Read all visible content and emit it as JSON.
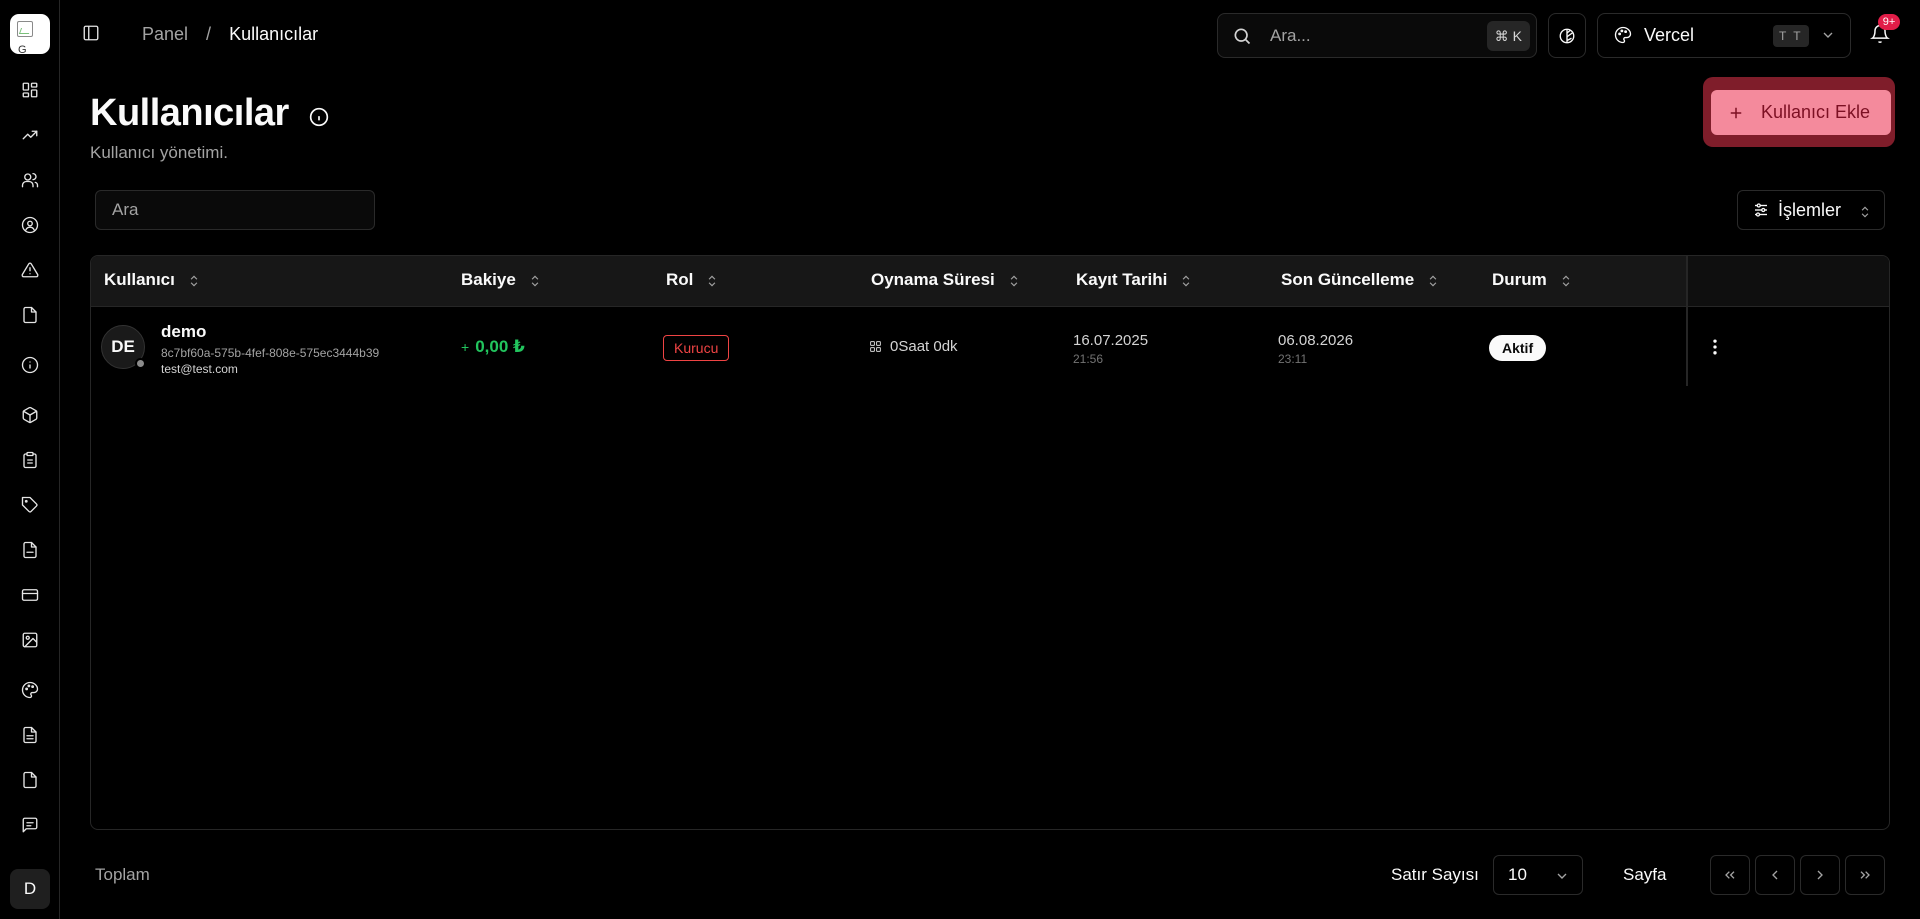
{
  "breadcrumb": {
    "root": "Panel",
    "separator": "/",
    "current": "Kullanıcılar"
  },
  "header": {
    "search_placeholder": "Ara...",
    "search_shortcut": "⌘ K",
    "theme_name": "Vercel",
    "theme_badge": "T T",
    "notification_count": "9+"
  },
  "page": {
    "title": "Kullanıcılar",
    "subtitle": "Kullanıcı yönetimi.",
    "add_button": "Kullanıcı Ekle",
    "filter_placeholder": "Ara",
    "actions_button": "İşlemler"
  },
  "table": {
    "columns": [
      "Kullanıcı",
      "Bakiye",
      "Rol",
      "Oynama Süresi",
      "Kayıt Tarihi",
      "Son Güncelleme",
      "Durum"
    ],
    "rows": [
      {
        "avatar_initials": "DE",
        "name": "demo",
        "id": "8c7bf60a-575b-4fef-808e-575ec3444b39",
        "email": "test@test.com",
        "balance_prefix": "+",
        "balance": "0,00 ₺",
        "role": "Kurucu",
        "play_time": "0Saat 0dk",
        "created_date": "16.07.2025",
        "created_time": "21:56",
        "updated_date": "06.08.2026",
        "updated_time": "23:11",
        "status": "Aktif"
      }
    ]
  },
  "footer": {
    "total_label": "Toplam",
    "rows_per_page_label": "Satır Sayısı",
    "rows_per_page_value": "10",
    "page_label": "Sayfa"
  },
  "sidebar": {
    "logo_label": "G",
    "user_initial": "D",
    "icons": [
      "dashboard-icon",
      "trending-icon",
      "users-icon",
      "user-circle-icon",
      "alert-triangle-icon",
      "file-icon",
      "info-icon",
      "box-icon",
      "clipboard-icon",
      "tag-icon",
      "pdf-icon",
      "credit-card-icon",
      "image-icon",
      "palette-icon",
      "file-text-icon",
      "file-icon",
      "message-icon"
    ]
  },
  "colors": {
    "accent": "#f48a9c",
    "accent_dark": "#7f1d2a",
    "success": "#22c55e",
    "danger": "#ef4444"
  }
}
